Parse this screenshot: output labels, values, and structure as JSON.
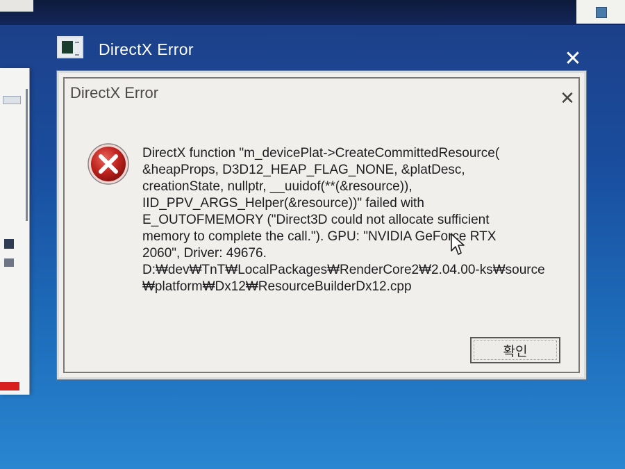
{
  "outer_window": {
    "title": "DirectX Error",
    "close_glyph": "✕"
  },
  "dialog": {
    "title": "DirectX Error",
    "close_glyph": "✕",
    "icon": "error-icon",
    "message_lines": [
      "DirectX function \"m_devicePlat->CreateCommittedResource(",
      "&heapProps, D3D12_HEAP_FLAG_NONE, &platDesc,",
      "creationState, nullptr, __uuidof(**(&resource)),",
      "IID_PPV_ARGS_Helper(&resource))\" failed with",
      "E_OUTOFMEMORY (\"Direct3D could not allocate sufficient",
      "memory to complete the call.\"). GPU: \"NVIDIA GeForce RTX",
      "2060\", Driver: 49676.",
      "D:₩dev₩TnT₩LocalPackages₩RenderCore2₩2.04.00-ks₩source",
      "₩platform₩Dx12₩ResourceBuilderDx12.cpp"
    ],
    "ok_button_label": "확인"
  },
  "colors": {
    "error_red": "#c0241f",
    "dialog_bg": "#f1efec",
    "desktop_blue": "#1a4d9e"
  }
}
